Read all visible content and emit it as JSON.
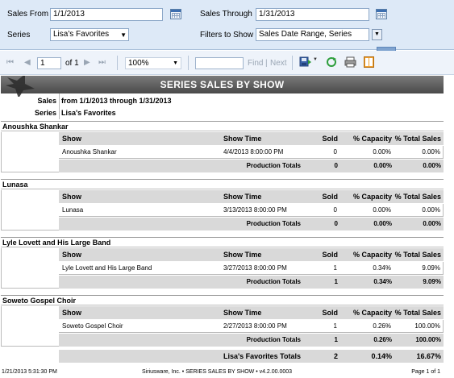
{
  "params": {
    "sales_from_label": "Sales From",
    "sales_from_value": "1/1/2013",
    "sales_through_label": "Sales Through",
    "sales_through_value": "1/31/2013",
    "series_label": "Series",
    "series_value": "Lisa's Favorites",
    "filters_label": "Filters to Show",
    "filters_value": "Sales Date Range, Series"
  },
  "toolbar": {
    "first_glyph": "⏮",
    "prev_glyph": "◀",
    "page_value": "1",
    "page_of": "of 1",
    "next_glyph": "▶",
    "last_glyph": "⏭",
    "zoom_value": "100%",
    "find_label": "Find",
    "separator": "|",
    "next_label": "Next"
  },
  "report": {
    "title": "SERIES SALES BY SHOW",
    "sales_label": "Sales",
    "sales_value": "from 1/1/2013 through 1/31/2013",
    "series_label": "Series",
    "series_value": "Lisa's Favorites",
    "columns": {
      "show": "Show",
      "time": "Show Time",
      "sold": "Sold",
      "capacity": "% Capacity",
      "total_sales": "% Total Sales"
    },
    "production_totals_label": "Production Totals",
    "groups": [
      {
        "name": "Anoushka Shankar",
        "show": "Anoushka Shankar",
        "time": "4/4/2013 8:00:00 PM",
        "sold": "0",
        "capacity": "0.00%",
        "total_sales": "0.00%",
        "tot_sold": "0",
        "tot_capacity": "0.00%",
        "tot_total_sales": "0.00%"
      },
      {
        "name": "Lunasa",
        "show": "Lunasa",
        "time": "3/13/2013 8:00:00 PM",
        "sold": "0",
        "capacity": "0.00%",
        "total_sales": "0.00%",
        "tot_sold": "0",
        "tot_capacity": "0.00%",
        "tot_total_sales": "0.00%"
      },
      {
        "name": "Lyle Lovett and His Large Band",
        "show": "Lyle Lovett and His Large Band",
        "time": "3/27/2013 8:00:00 PM",
        "sold": "1",
        "capacity": "0.34%",
        "total_sales": "9.09%",
        "tot_sold": "1",
        "tot_capacity": "0.34%",
        "tot_total_sales": "9.09%"
      },
      {
        "name": "Soweto Gospel Choir",
        "show": "Soweto Gospel Choir",
        "time": "2/27/2013 8:00:00 PM",
        "sold": "1",
        "capacity": "0.26%",
        "total_sales": "100.00%",
        "tot_sold": "1",
        "tot_capacity": "0.26%",
        "tot_total_sales": "100.00%"
      }
    ],
    "grand_label": "Lisa's Favorites Totals",
    "grand_sold": "2",
    "grand_capacity": "0.14%",
    "grand_total_sales": "16.67%",
    "footer_left": "1/21/2013 5:31:30 PM",
    "footer_center": "Siriusware, Inc. • SERIES SALES BY SHOW • v4.2.00.0003",
    "footer_right": "Page 1 of 1"
  }
}
